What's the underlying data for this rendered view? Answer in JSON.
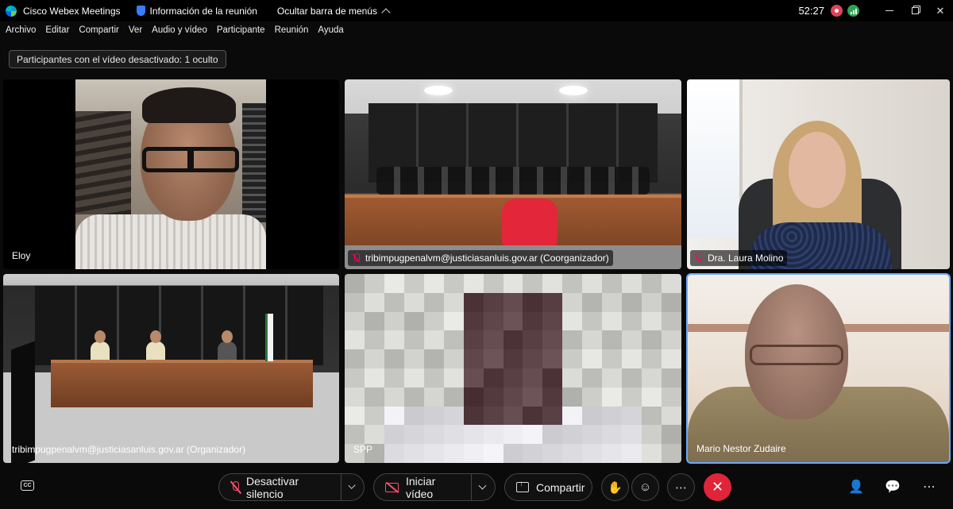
{
  "titlebar": {
    "app_name": "Cisco Webex Meetings",
    "meeting_info": "Información de la reunión",
    "hide_menu": "Ocultar barra de menús",
    "timer": "52:27"
  },
  "menu": [
    {
      "label": "Archivo"
    },
    {
      "label": "Editar"
    },
    {
      "label": "Compartir"
    },
    {
      "label": "Ver"
    },
    {
      "label": "Audio y vídeo"
    },
    {
      "label": "Participante"
    },
    {
      "label": "Reunión"
    },
    {
      "label": "Ayuda"
    }
  ],
  "hidden_participants": "Participantes con el vídeo desactivado: 1 oculto",
  "tiles": [
    {
      "name": "Eloy",
      "muted": false
    },
    {
      "name": "tribimpugpenalvm@justiciasanluis.gov.ar (Coorganizador)",
      "muted": true
    },
    {
      "name": "Dra. Laura Molino",
      "muted": true
    },
    {
      "name": "tribimpugpenalvm@justiciasanluis.gov.ar (Organizador)",
      "muted": false
    },
    {
      "name": "SPP",
      "muted": false
    },
    {
      "name": "Mario Nestor Zudaire",
      "muted": false,
      "active_speaker": true
    }
  ],
  "toolbar": {
    "mute_label": "Desactivar silencio",
    "video_label": "Iniciar vídeo",
    "share_label": "Compartir",
    "cc_label": "CC"
  },
  "colors": {
    "accent_red": "#e0253a",
    "mute_red": "#ff4d6d",
    "active_outline": "#6aa8ff"
  }
}
